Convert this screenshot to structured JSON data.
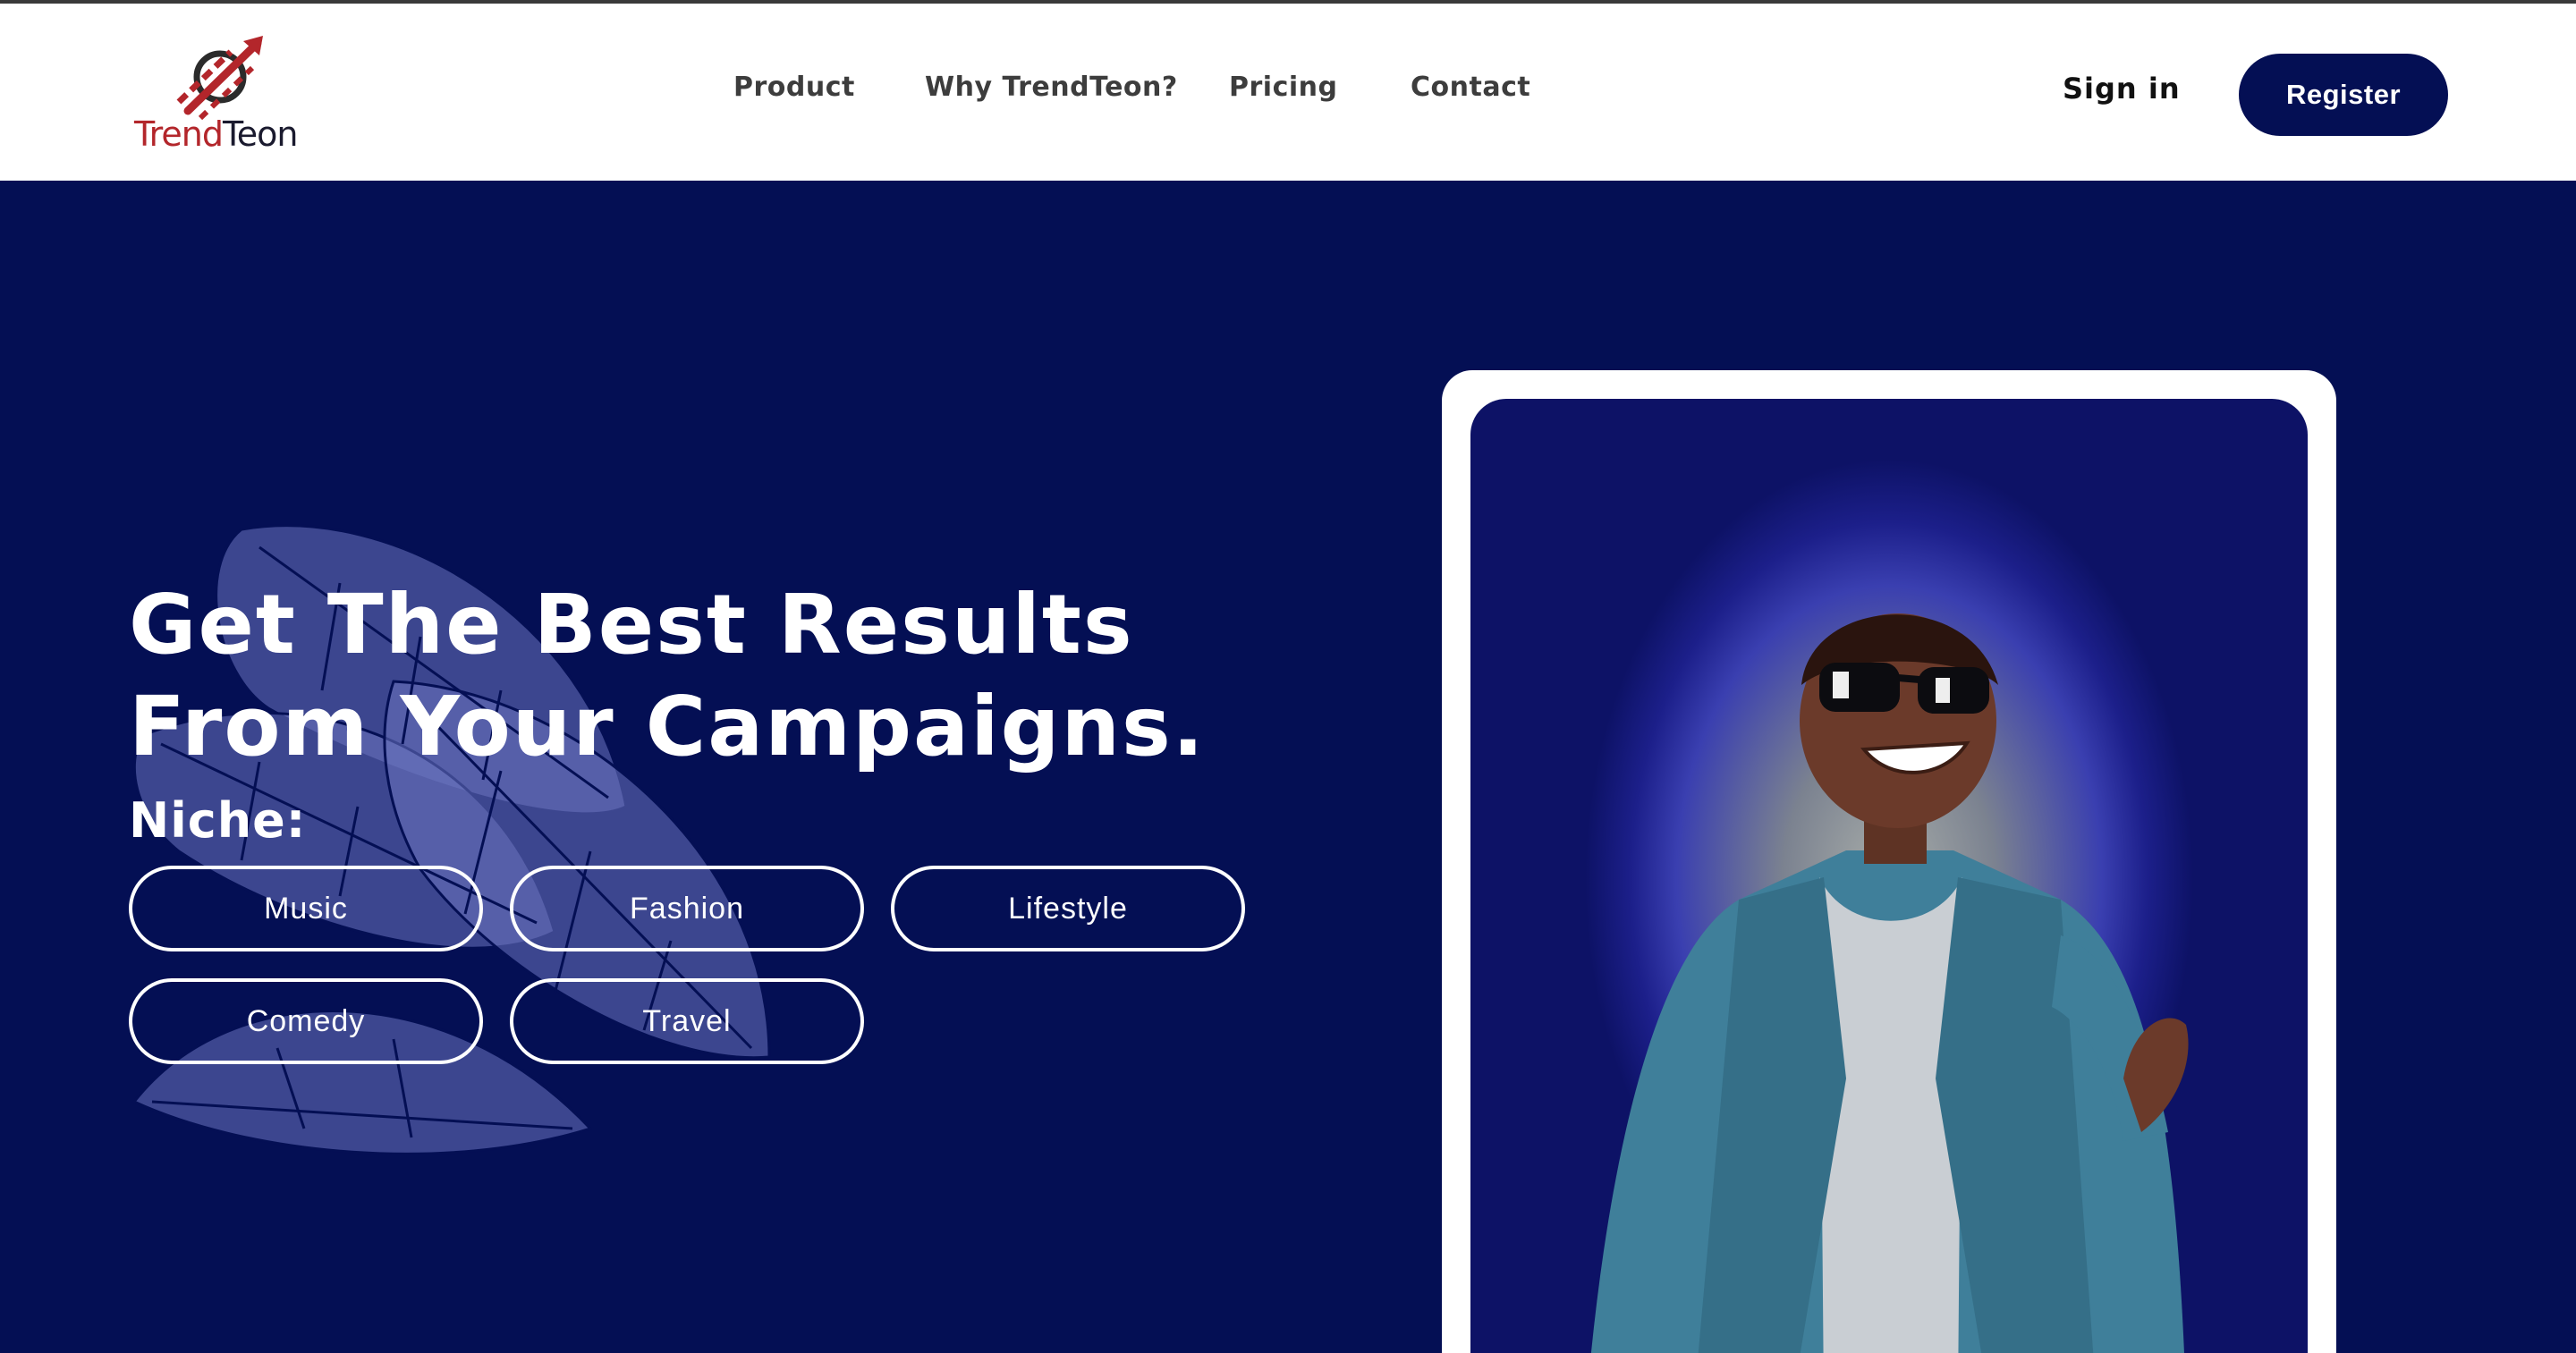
{
  "brand": {
    "name_part1": "Trend",
    "name_part2": "Teon",
    "color_primary": "#b3262b",
    "color_dark": "#040f54"
  },
  "nav": {
    "product": "Product",
    "why": "Why TrendTeon?",
    "pricing": "Pricing",
    "contact": "Contact"
  },
  "auth": {
    "sign_in": "Sign in",
    "register": "Register"
  },
  "hero": {
    "headline_line1": "Get The Best Results",
    "headline_line2": "From Your Campaigns.",
    "niche_label": "Niche:",
    "niches": [
      "Music",
      "Fashion",
      "Lifestyle",
      "Comedy",
      "Travel"
    ]
  },
  "icons": {
    "logo": "trendteon-logo-icon",
    "decor": "leaf-decoration-icon"
  }
}
